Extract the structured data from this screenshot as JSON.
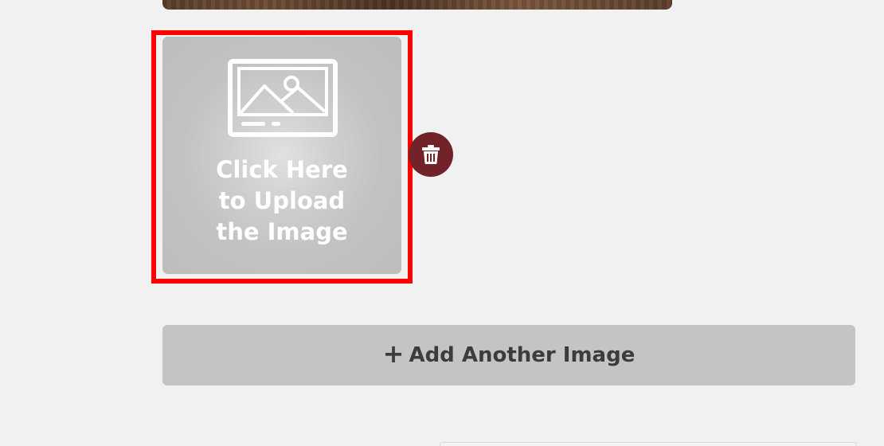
{
  "upload_tile": {
    "label": "Click Here\nto Upload\nthe Image",
    "icon": "image-placeholder-icon"
  },
  "delete_button": {
    "icon": "trash-icon",
    "color": "#72232a"
  },
  "add_button": {
    "icon": "plus-icon",
    "label": "Add Another Image"
  },
  "highlight_color": "#ff0000"
}
